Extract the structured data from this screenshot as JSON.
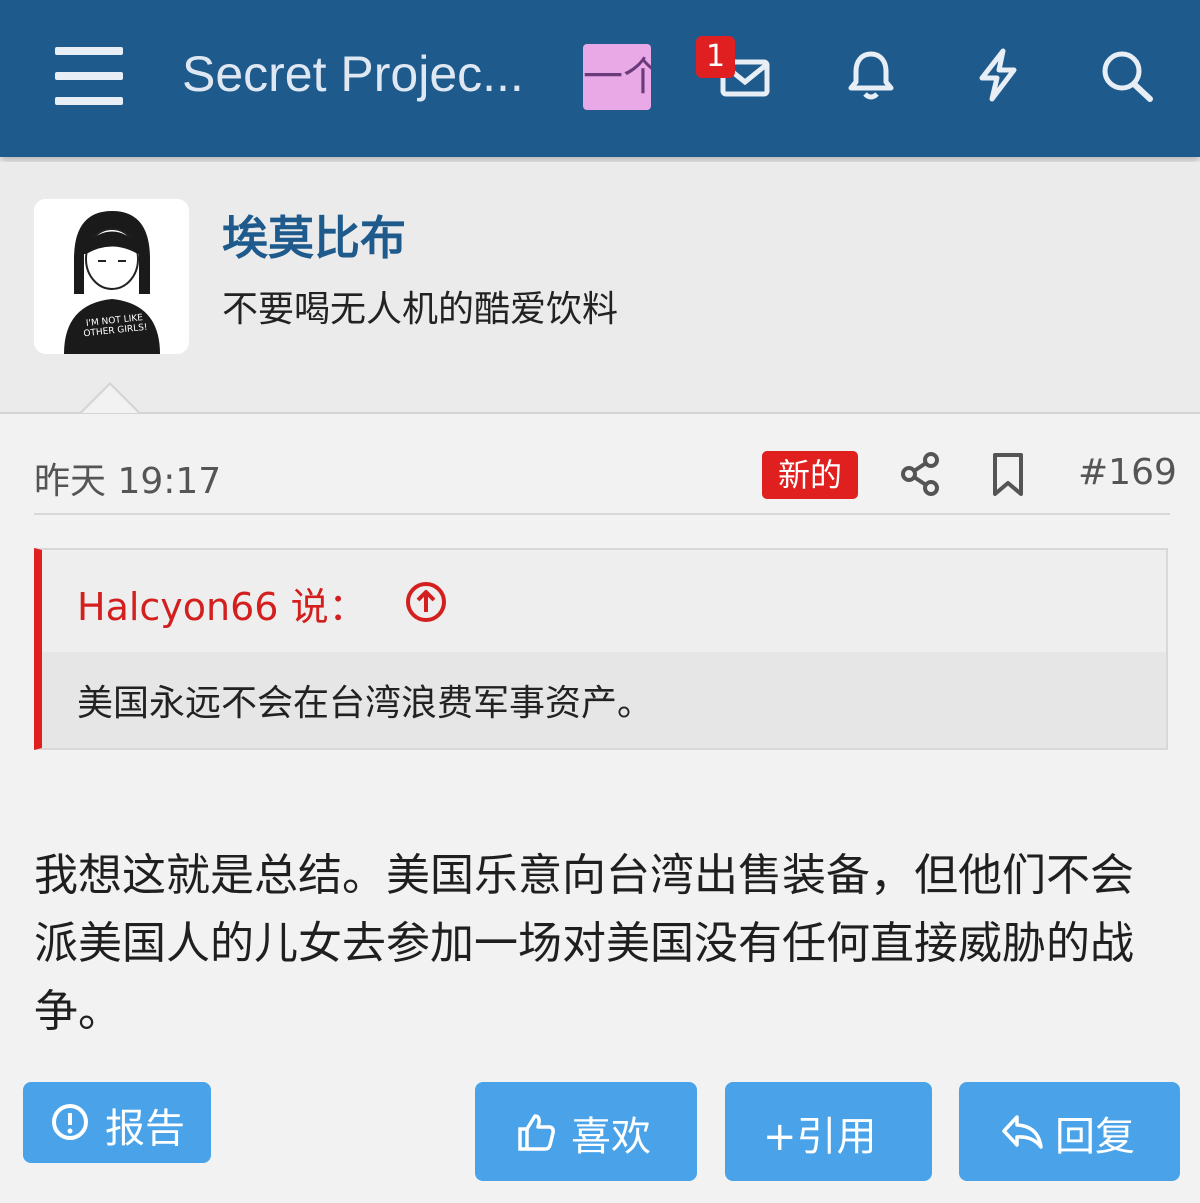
{
  "header": {
    "site_title": "Secret Projec...",
    "pink_box_text": "一个",
    "notification_badge": "1",
    "icons": [
      "menu-icon",
      "envelope-icon",
      "bell-icon",
      "lightning-icon",
      "search-icon"
    ],
    "color": "#1e5a8c"
  },
  "author": {
    "name": "埃莫比布",
    "title": "不要喝无人机的酷爱饮料",
    "avatar_caption": "I'M NOT LIKE OTHER GIRLS!"
  },
  "post": {
    "time": "昨天 19:17",
    "new_badge": "新的",
    "number": "#169",
    "quote": {
      "author": "Halcyon66 说：",
      "text": "美国永远不会在台湾浪费军事资产。"
    },
    "body": "我想这就是总结。美国乐意向台湾出售装备，但他们不会派美国人的儿女去参加一场对美国没有任何直接威胁的战争。"
  },
  "actions": {
    "report": "报告",
    "like": "喜欢",
    "quote": "+引用",
    "reply": "回复"
  },
  "colors": {
    "accent": "#1e5a8c",
    "button": "#4aa3e8",
    "alert": "#e01f1f"
  }
}
